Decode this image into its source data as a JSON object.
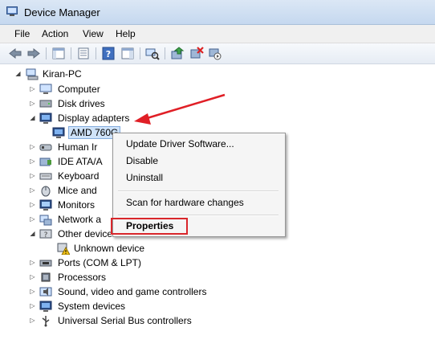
{
  "window": {
    "title": "Device Manager"
  },
  "menu": [
    "File",
    "Action",
    "View",
    "Help"
  ],
  "toolbar": {
    "icons": [
      "back-icon",
      "forward-icon",
      "console-tree-icon",
      "properties-icon",
      "help-icon",
      "action-pane-icon",
      "scan-hardware-icon",
      "update-driver-icon",
      "uninstall-icon",
      "disable-icon"
    ]
  },
  "tree": {
    "root": "Kiran-PC",
    "items": [
      {
        "label": "Computer",
        "icon": "computer-icon"
      },
      {
        "label": "Disk drives",
        "icon": "disk-drive-icon"
      },
      {
        "label": "Display adapters",
        "icon": "display-adapter-icon"
      },
      {
        "label": "AMD 760G",
        "icon": "display-adapter-icon"
      },
      {
        "label": "Human Ir",
        "icon": "hid-icon"
      },
      {
        "label": "IDE ATA/A",
        "icon": "ide-controller-icon"
      },
      {
        "label": "Keyboard",
        "icon": "keyboard-icon"
      },
      {
        "label": "Mice and",
        "icon": "mouse-icon"
      },
      {
        "label": "Monitors",
        "icon": "monitor-icon"
      },
      {
        "label": "Network a",
        "icon": "network-adapter-icon"
      },
      {
        "label": "Other devices",
        "icon": "other-devices-icon"
      },
      {
        "label": "Unknown device",
        "icon": "unknown-device-warning-icon"
      },
      {
        "label": "Ports (COM & LPT)",
        "icon": "port-icon"
      },
      {
        "label": "Processors",
        "icon": "processor-icon"
      },
      {
        "label": "Sound, video and game controllers",
        "icon": "sound-icon"
      },
      {
        "label": "System devices",
        "icon": "system-devices-icon"
      },
      {
        "label": "Universal Serial Bus controllers",
        "icon": "usb-icon"
      }
    ]
  },
  "context_menu": {
    "items": [
      "Update Driver Software...",
      "Disable",
      "Uninstall",
      "Scan for hardware changes",
      "Properties"
    ]
  },
  "colors": {
    "highlight_box": "#d9262b",
    "arrow": "#e01f26",
    "selection": "#cfe3f9"
  }
}
